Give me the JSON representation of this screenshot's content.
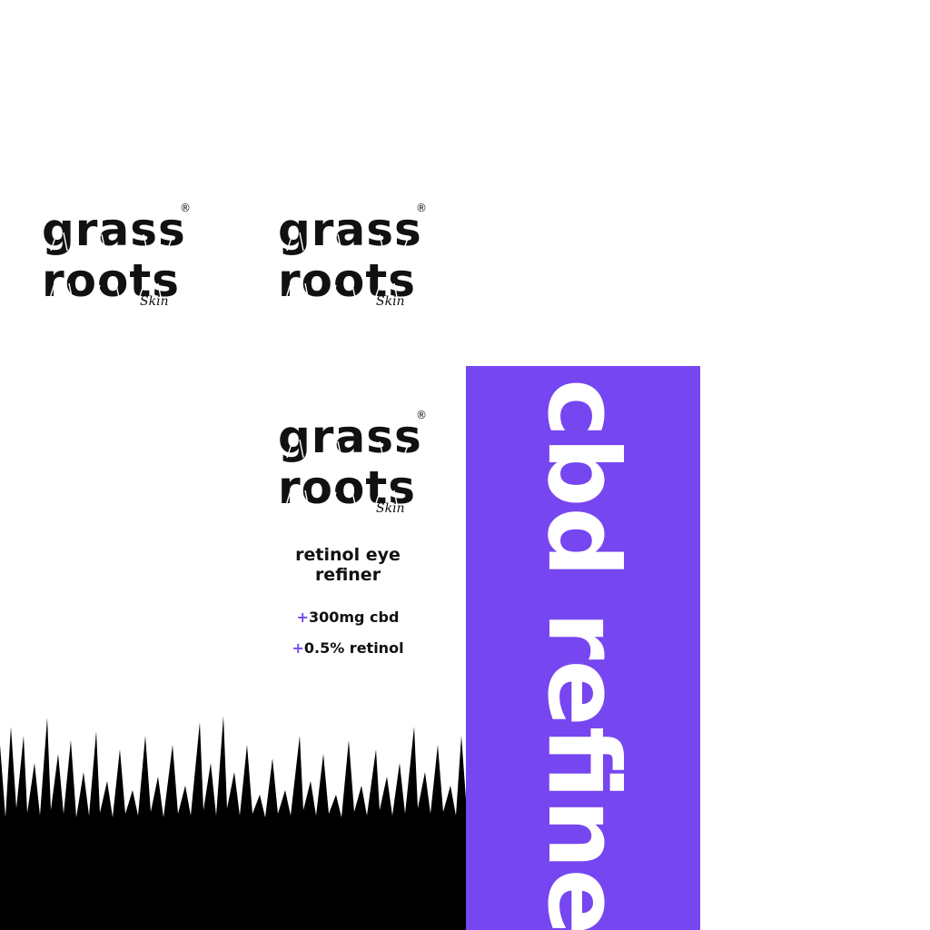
{
  "brand": {
    "line1": "grass",
    "line2": "roots",
    "registered": "®",
    "sub": "Skin"
  },
  "product": {
    "name": "retinol eye refiner",
    "specs": [
      {
        "plus": "+",
        "text": "300mg cbd"
      },
      {
        "plus": "+",
        "text": "0.5% retinol"
      }
    ]
  },
  "side_panel": {
    "text": "cbd refine",
    "color": "#7646F0"
  },
  "colors": {
    "accent": "#7646F0",
    "text": "#111111",
    "background": "#ffffff"
  }
}
